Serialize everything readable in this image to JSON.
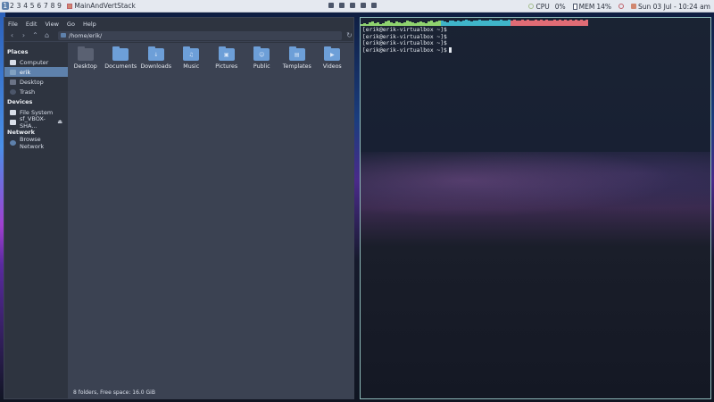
{
  "topbar": {
    "workspaces": [
      "1",
      "2",
      "3",
      "4",
      "5",
      "6",
      "7",
      "8",
      "9"
    ],
    "active_workspace": "1",
    "layout_label": "MainAndVertStack",
    "cpu_label": "CPU",
    "cpu_value": "0%",
    "mem_label": "MEM",
    "mem_value": "14%",
    "datetime": "Sun 03 Jul - 10:24 am"
  },
  "filemanager": {
    "menu": [
      "File",
      "Edit",
      "View",
      "Go",
      "Help"
    ],
    "path": "/home/erik/",
    "sidebar": {
      "places_title": "Places",
      "places": [
        "Computer",
        "erik",
        "Desktop",
        "Trash"
      ],
      "devices_title": "Devices",
      "devices": [
        "File System",
        "sf_VBOX-SHA..."
      ],
      "network_title": "Network",
      "network": [
        "Browse Network"
      ]
    },
    "folders": [
      "Desktop",
      "Documents",
      "Downloads",
      "Music",
      "Pictures",
      "Public",
      "Templates",
      "Videos"
    ],
    "status": "8 folders, Free space: 16.0 GiB"
  },
  "terminal": {
    "lines": [
      "[erik@erik-virtualbox ~]$",
      "[erik@erik-virtualbox ~]$",
      "[erik@erik-virtualbox ~]$",
      "[erik@erik-virtualbox ~]$"
    ],
    "cpu_history": [
      0.3,
      0.4,
      0.3,
      0.5,
      0.6,
      0.4,
      0.5,
      0.3,
      0.4,
      0.6,
      0.7,
      0.5,
      0.4,
      0.6,
      0.5,
      0.4,
      0.5,
      0.7,
      0.6,
      0.5,
      0.4,
      0.5,
      0.6,
      0.5,
      0.4,
      0.6,
      0.7,
      0.5,
      0.6,
      0.8,
      0.7,
      0.6,
      0.5,
      0.7,
      0.8,
      0.6,
      0.7,
      0.6,
      0.8,
      0.9,
      0.7,
      0.6,
      0.8,
      0.7,
      0.9,
      0.8,
      0.7,
      0.8,
      0.9,
      0.8,
      0.7,
      0.8,
      0.9,
      0.7,
      0.8,
      0.9,
      0.8,
      0.9,
      0.7,
      0.8,
      0.9,
      0.8,
      0.9,
      0.8,
      0.7,
      0.9,
      0.8,
      0.9,
      0.8,
      0.9,
      0.7,
      0.8,
      0.9,
      0.8,
      0.9,
      0.8,
      0.9,
      0.8,
      0.9,
      0.8,
      0.9,
      0.8,
      0.9,
      0.8,
      0.9
    ],
    "colors": {
      "low": "#8fd26f",
      "mid": "#3fb5c9",
      "high": "#e06c75"
    }
  }
}
